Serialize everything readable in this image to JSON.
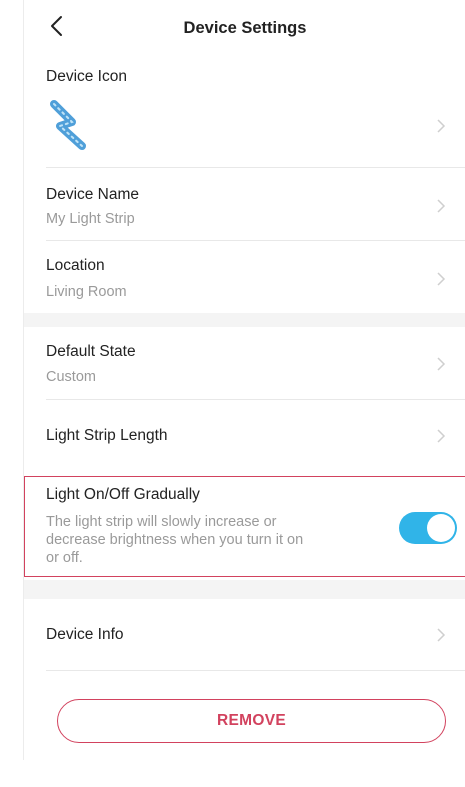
{
  "header": {
    "title": "Device Settings"
  },
  "device_icon": {
    "label": "Device Icon",
    "icon": "light-strip-icon"
  },
  "device_name": {
    "label": "Device Name",
    "value": "My Light Strip"
  },
  "location": {
    "label": "Location",
    "value": "Living Room"
  },
  "default_state": {
    "label": "Default State",
    "value": "Custom"
  },
  "strip_length": {
    "label": "Light Strip Length"
  },
  "gradual": {
    "label": "Light On/Off Gradually",
    "description_lines": [
      "The light strip will slowly increase or",
      "decrease brightness when you turn it on",
      "or off."
    ],
    "enabled": true
  },
  "device_info": {
    "label": "Device Info"
  },
  "remove": {
    "label": "REMOVE"
  },
  "colors": {
    "accent": "#30b4e8",
    "danger": "#d2425e",
    "muted": "#9a9a9a"
  }
}
